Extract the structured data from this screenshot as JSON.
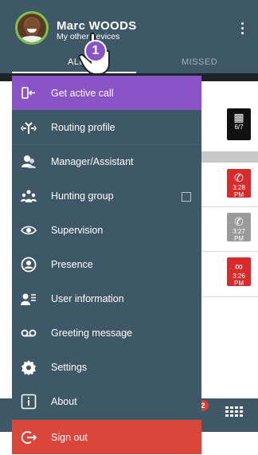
{
  "header": {
    "user_name": "Marc WOODS",
    "user_sub": "My other devices",
    "menu_icon": "kebab-icon"
  },
  "tabs": [
    {
      "label": "ALL",
      "active": true
    },
    {
      "label": "MISSED",
      "active": false
    }
  ],
  "background_list": {
    "tiles": [
      {
        "icon": "calendar-icon",
        "line1": "6/7",
        "color": "#111111"
      },
      {
        "icon": "phone-outgoing-icon",
        "line1": "3:28",
        "line2": "PM",
        "color": "#d92b2b"
      },
      {
        "icon": "phone-outgoing-icon",
        "line1": "3:27",
        "line2": "PM",
        "color": "#9a9a9a"
      },
      {
        "icon": "voicemail-icon",
        "line1": "3:26",
        "line2": "PM",
        "color": "#d92b2b"
      }
    ]
  },
  "bottom_bar": {
    "badge_count": "2",
    "dialpad_icon": "dialpad-icon"
  },
  "drawer": {
    "items": [
      {
        "label": "Get active call",
        "icon": "get-call-icon",
        "state": "active"
      },
      {
        "label": "Routing profile",
        "icon": "routing-icon"
      },
      {
        "label": "Manager/Assistant",
        "icon": "manager-icon"
      },
      {
        "label": "Hunting group",
        "icon": "group-icon"
      },
      {
        "label": "Supervision",
        "icon": "eye-icon"
      },
      {
        "label": "Presence",
        "icon": "presence-icon"
      },
      {
        "label": "User information",
        "icon": "user-info-icon"
      },
      {
        "label": "Greeting message",
        "icon": "voicemail-icon"
      },
      {
        "label": "Settings",
        "icon": "gear-icon"
      },
      {
        "label": "About",
        "icon": "info-icon"
      },
      {
        "label": "Sign out",
        "icon": "sign-out-icon",
        "state": "danger"
      }
    ]
  },
  "overlay": {
    "step_number": "1"
  },
  "colors": {
    "header": "#3f5868",
    "active": "#8a53c6",
    "signout": "#d9473b",
    "avatar_ring": "#7dc242"
  }
}
